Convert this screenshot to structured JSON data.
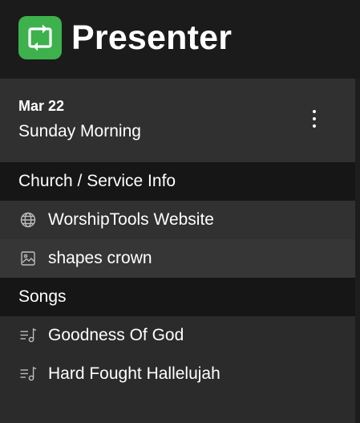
{
  "app": {
    "title": "Presenter",
    "logo_icon": "presenter-loop-icon",
    "accent": "#3db14c"
  },
  "service": {
    "date": "Mar 22",
    "name": "Sunday Morning",
    "menu_icon": "kebab-menu-icon"
  },
  "sections": [
    {
      "label": "Church / Service Info",
      "items": [
        {
          "label": "WorshipTools Website",
          "icon": "globe-icon"
        },
        {
          "label": "shapes crown",
          "icon": "image-icon"
        }
      ]
    },
    {
      "label": "Songs",
      "items": [
        {
          "label": "Goodness Of God",
          "icon": "song-list-icon"
        },
        {
          "label": "Hard Fought Hallelujah",
          "icon": "song-list-icon"
        }
      ]
    }
  ],
  "colors": {
    "header_bg": "#1b1b1b",
    "panel_bg": "#2b2b2b",
    "card_bg": "#303030",
    "section_bg": "#161616",
    "selected_row_bg": "#363636",
    "highlight_row_bg": "#313131"
  }
}
